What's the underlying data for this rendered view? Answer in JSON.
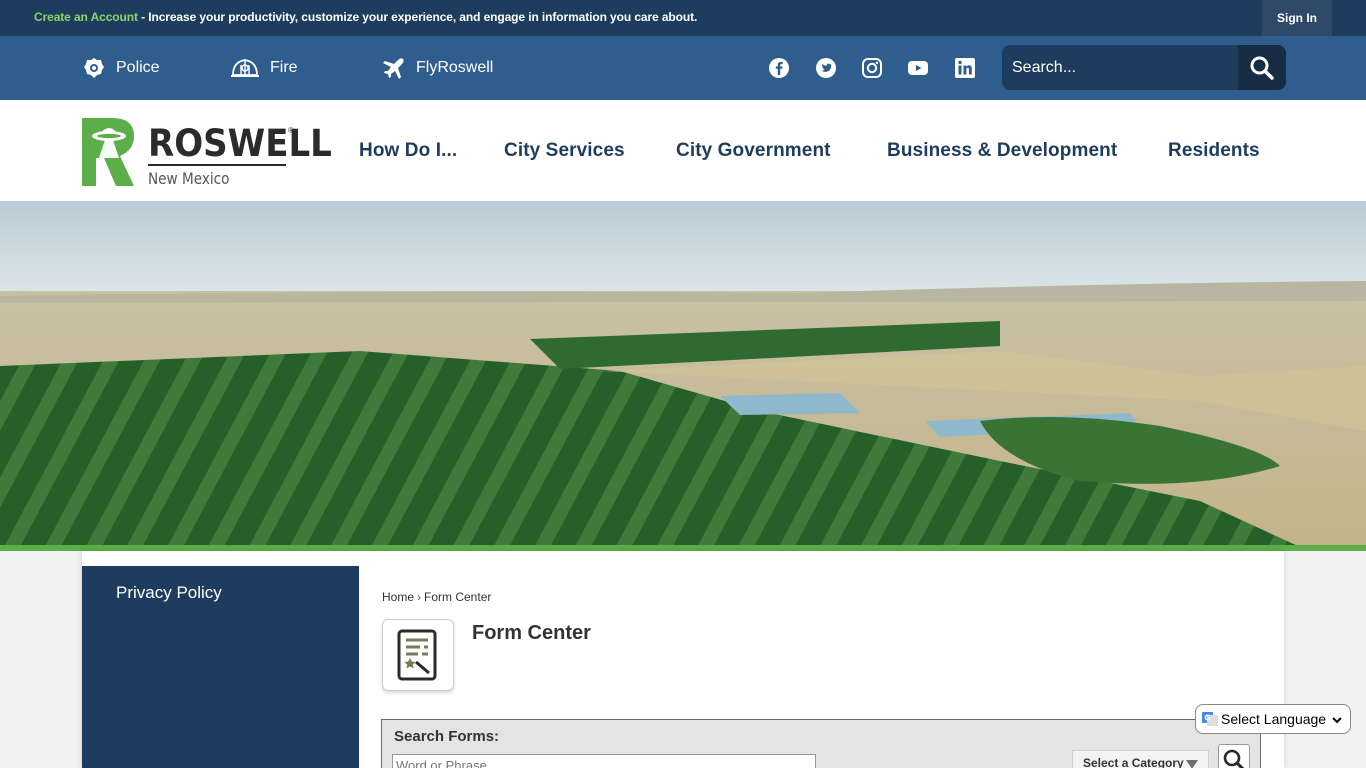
{
  "topbar": {
    "create_account": "Create an Account",
    "message": " - Increase your productivity, customize your experience, and engage in information you care about.",
    "sign_in": "Sign In"
  },
  "quicklinks": [
    {
      "label": "Police",
      "icon": "police-badge-icon"
    },
    {
      "label": "Fire",
      "icon": "fire-helmet-icon"
    },
    {
      "label": "FlyRoswell",
      "icon": "airplane-icon"
    }
  ],
  "social": [
    "facebook-icon",
    "twitter-icon",
    "instagram-icon",
    "youtube-icon",
    "linkedin-icon"
  ],
  "search": {
    "placeholder": "Search..."
  },
  "logo": {
    "name": "ROSWELL",
    "reg": "®",
    "subtitle": "New Mexico"
  },
  "nav": [
    "How Do I...",
    "City Services",
    "City Government",
    "Business & Development",
    "Residents"
  ],
  "sidebar": {
    "items": [
      "Privacy Policy"
    ]
  },
  "breadcrumb": {
    "home": "Home",
    "sep": "›",
    "current": "Form Center"
  },
  "page": {
    "title": "Form Center"
  },
  "form_search": {
    "label": "Search Forms:",
    "placeholder": "Word or Phrase",
    "category": "Select a Category"
  },
  "translate": {
    "label": "Select Language"
  },
  "colors": {
    "navy": "#1e3d5e",
    "blue": "#2f5e8e",
    "green": "#5cae4a",
    "accent_green": "#8fd26a"
  }
}
